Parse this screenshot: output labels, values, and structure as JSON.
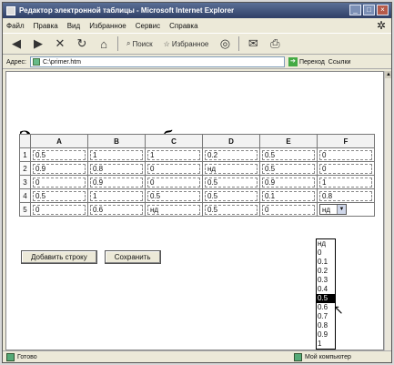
{
  "window": {
    "title": "Редактор электронной таблицы - Microsoft Internet Explorer",
    "controls": [
      "_",
      "□",
      "×"
    ]
  },
  "menu": {
    "items": [
      "Файл",
      "Правка",
      "Вид",
      "Избранное",
      "Сервис",
      "Справка"
    ]
  },
  "toolbar": {
    "back_icon": "back-arrow-icon",
    "search_label": "Поиск",
    "favorites_label": "Избранное"
  },
  "address": {
    "label": "Адрес:",
    "value": "C:\\primer.htm",
    "go_label": "Переход",
    "links_label": "Ссылки"
  },
  "page": {
    "title": "Электронная таблица"
  },
  "table": {
    "columns": [
      "A",
      "B",
      "C",
      "D",
      "E",
      "F"
    ],
    "rows": [
      {
        "num": "1",
        "cells": [
          "0.5",
          "1",
          "1",
          "0.2",
          "0.5",
          "0"
        ]
      },
      {
        "num": "2",
        "cells": [
          "0.9",
          "0.8",
          "0",
          "нд",
          "0.5",
          "0"
        ]
      },
      {
        "num": "3",
        "cells": [
          "0",
          "0.9",
          "0",
          "0.5",
          "0.9",
          "1"
        ]
      },
      {
        "num": "4",
        "cells": [
          "0.5",
          "1",
          "0.5",
          "0.5",
          "0.1",
          "0.8"
        ]
      },
      {
        "num": "5",
        "cells": [
          "0",
          "0.6",
          "нд",
          "0.5",
          "0",
          "нд"
        ]
      }
    ]
  },
  "buttons": {
    "add_row": "Добавить строку",
    "save": "Сохранить"
  },
  "dropdown": {
    "options": [
      "нд",
      "0",
      "0.1",
      "0.2",
      "0.3",
      "0.4",
      "0.5",
      "0.6",
      "0.7",
      "0.8",
      "0.9",
      "1"
    ],
    "highlighted": "0.5"
  },
  "status": {
    "left": "Готово",
    "right": "Мой компьютер"
  }
}
